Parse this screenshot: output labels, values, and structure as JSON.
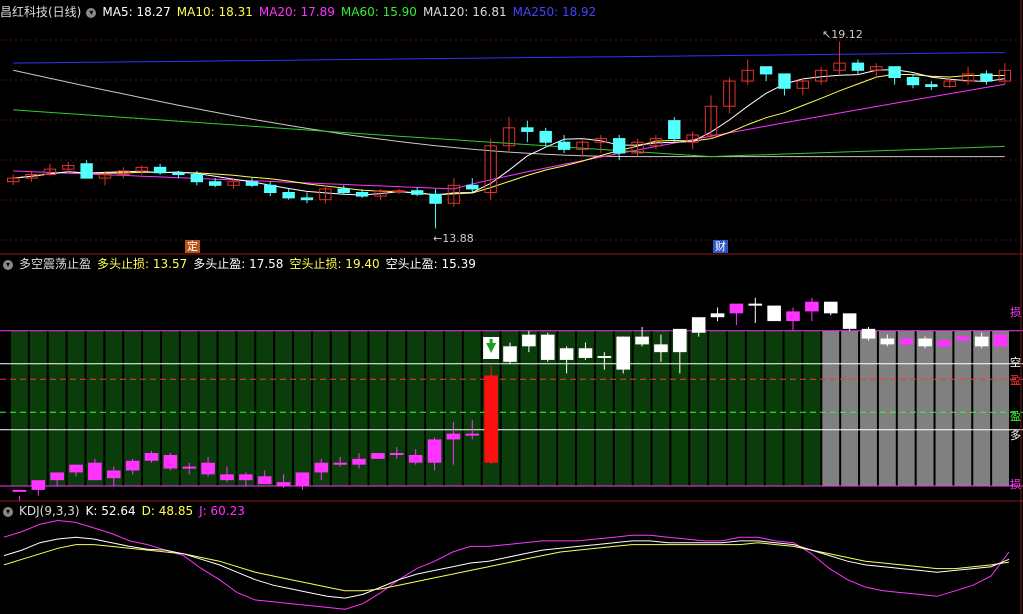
{
  "header_main": {
    "title": "昌红科技(日线)",
    "ma5": "MA5: 18.27",
    "ma10": "MA10: 18.31",
    "ma20": "MA20: 17.89",
    "ma60": "MA60: 15.90",
    "ma120": "MA120: 16.81",
    "ma250": "MA250: 18.92"
  },
  "header_ind": {
    "title": "多空震荡止盈",
    "duo_stop_loss": "多头止损: 13.57",
    "duo_take_profit": "多头止盈: 17.58",
    "kong_stop_loss": "空头止损: 19.40",
    "kong_take_profit": "空头止盈: 15.39"
  },
  "header_kdj": {
    "title": "KDJ(9,3,3)",
    "k": "K: 52.64",
    "d": "D: 48.85",
    "j": "J: 60.23"
  },
  "annotations": {
    "high": "19.12",
    "low": "13.88",
    "badge_ding": "定",
    "badge_cai": "财"
  },
  "right_labels": {
    "sun_top": "损",
    "kong": "空",
    "ying_red": "盈",
    "ying_green": "盈",
    "duo": "多",
    "sun_bottom": "损"
  },
  "colors": {
    "up": "#e0342c",
    "down": "#54ffff",
    "ma5": "#ffffff",
    "ma10": "#ffff55",
    "ma20": "#ff33ff",
    "ma60": "#33cc33",
    "ma120": "#c8c8c8",
    "ma250": "#3333ff",
    "panel_green": "#0b3d0b",
    "panel_gray": "#808080"
  },
  "chart_data": {
    "type": "candlestick",
    "price_ylim": [
      13.3,
      19.7
    ],
    "candles": [
      [
        15.2,
        15.4,
        15.1,
        15.3
      ],
      [
        15.3,
        15.5,
        15.2,
        15.4
      ],
      [
        15.4,
        15.7,
        15.35,
        15.55
      ],
      [
        15.55,
        15.75,
        15.45,
        15.65
      ],
      [
        15.7,
        15.8,
        15.4,
        15.3
      ],
      [
        15.3,
        15.5,
        15.1,
        15.4
      ],
      [
        15.4,
        15.6,
        15.3,
        15.5
      ],
      [
        15.5,
        15.65,
        15.4,
        15.6
      ],
      [
        15.6,
        15.7,
        15.4,
        15.45
      ],
      [
        15.45,
        15.5,
        15.3,
        15.4
      ],
      [
        15.4,
        15.5,
        15.1,
        15.2
      ],
      [
        15.2,
        15.3,
        15.05,
        15.1
      ],
      [
        15.1,
        15.3,
        15.0,
        15.2
      ],
      [
        15.2,
        15.3,
        15.05,
        15.1
      ],
      [
        15.1,
        15.2,
        14.8,
        14.9
      ],
      [
        14.9,
        15.0,
        14.7,
        14.75
      ],
      [
        14.75,
        14.9,
        14.6,
        14.7
      ],
      [
        14.7,
        15.1,
        14.6,
        15.0
      ],
      [
        15.0,
        15.1,
        14.85,
        14.9
      ],
      [
        14.9,
        15.0,
        14.75,
        14.8
      ],
      [
        14.8,
        15.0,
        14.7,
        14.95
      ],
      [
        14.95,
        15.0,
        14.85,
        14.95
      ],
      [
        14.95,
        15.05,
        14.8,
        14.85
      ],
      [
        14.85,
        15.0,
        13.9,
        14.6
      ],
      [
        14.6,
        15.3,
        14.5,
        15.1
      ],
      [
        15.1,
        15.3,
        14.9,
        15.0
      ],
      [
        14.9,
        16.4,
        14.7,
        16.2
      ],
      [
        16.2,
        17.0,
        16.0,
        16.7
      ],
      [
        16.7,
        16.9,
        16.3,
        16.6
      ],
      [
        16.6,
        16.7,
        16.2,
        16.3
      ],
      [
        16.3,
        16.5,
        16.0,
        16.1
      ],
      [
        16.1,
        16.4,
        15.9,
        16.3
      ],
      [
        16.3,
        16.5,
        16.0,
        16.4
      ],
      [
        16.4,
        16.5,
        15.8,
        16.0
      ],
      [
        16.0,
        16.4,
        15.9,
        16.3
      ],
      [
        16.2,
        16.5,
        16.1,
        16.4
      ],
      [
        16.9,
        17.0,
        16.3,
        16.4
      ],
      [
        16.3,
        16.6,
        16.1,
        16.5
      ],
      [
        16.5,
        17.6,
        16.4,
        17.3
      ],
      [
        17.3,
        18.1,
        17.1,
        18.0
      ],
      [
        18.0,
        18.6,
        17.9,
        18.3
      ],
      [
        18.4,
        18.3,
        18.0,
        18.2
      ],
      [
        18.2,
        18.2,
        17.6,
        17.8
      ],
      [
        17.8,
        18.1,
        17.6,
        18.0
      ],
      [
        18.0,
        18.4,
        17.9,
        18.3
      ],
      [
        18.3,
        19.1,
        18.2,
        18.5
      ],
      [
        18.5,
        18.6,
        18.2,
        18.3
      ],
      [
        18.3,
        18.5,
        18.1,
        18.4
      ],
      [
        18.4,
        18.4,
        17.9,
        18.1
      ],
      [
        18.1,
        18.2,
        17.8,
        17.9
      ],
      [
        17.9,
        18.0,
        17.75,
        17.85
      ],
      [
        17.85,
        18.1,
        17.8,
        18.0
      ],
      [
        18.0,
        18.4,
        17.9,
        18.2
      ],
      [
        18.2,
        18.3,
        17.9,
        18.0
      ],
      [
        18.0,
        18.5,
        17.9,
        18.3
      ]
    ],
    "indicator": {
      "top_line": 0.8,
      "kong_line": 0.63,
      "ying_red_line": 0.55,
      "ying_green_line": 0.38,
      "duo_line": 0.29,
      "bottom_line": 0.0,
      "gray_from_index": 43,
      "candles": [
        [
          -0.02,
          -0.05,
          -0.08,
          -0.02
        ],
        [
          -0.02,
          0.02,
          -0.05,
          0.03
        ],
        [
          0.03,
          0.06,
          0.0,
          0.07
        ],
        [
          0.07,
          0.1,
          0.05,
          0.11
        ],
        [
          0.12,
          0.14,
          0.04,
          0.03
        ],
        [
          0.04,
          0.1,
          0.0,
          0.08
        ],
        [
          0.08,
          0.14,
          0.06,
          0.13
        ],
        [
          0.13,
          0.18,
          0.12,
          0.17
        ],
        [
          0.16,
          0.17,
          0.08,
          0.09
        ],
        [
          0.09,
          0.12,
          0.06,
          0.1
        ],
        [
          0.12,
          0.15,
          0.05,
          0.06
        ],
        [
          0.06,
          0.1,
          0.02,
          0.03
        ],
        [
          0.03,
          0.07,
          0.0,
          0.06
        ],
        [
          0.05,
          0.08,
          0.01,
          0.01
        ],
        [
          0.02,
          0.06,
          -0.01,
          0.0
        ],
        [
          0.0,
          0.06,
          -0.02,
          0.07
        ],
        [
          0.07,
          0.14,
          0.03,
          0.12
        ],
        [
          0.12,
          0.15,
          0.1,
          0.11
        ],
        [
          0.11,
          0.17,
          0.09,
          0.14
        ],
        [
          0.14,
          0.17,
          0.14,
          0.17
        ],
        [
          0.17,
          0.2,
          0.14,
          0.16
        ],
        [
          0.16,
          0.19,
          0.11,
          0.12
        ],
        [
          0.12,
          0.25,
          0.08,
          0.24
        ],
        [
          0.24,
          0.33,
          0.11,
          0.27
        ],
        [
          0.26,
          0.34,
          0.24,
          0.27
        ],
        [
          0.12,
          0.62,
          0.11,
          0.57
        ],
        [
          0.64,
          0.74,
          0.63,
          0.72
        ],
        [
          0.72,
          0.8,
          0.69,
          0.78
        ],
        [
          0.78,
          0.79,
          0.64,
          0.65
        ],
        [
          0.65,
          0.72,
          0.58,
          0.71
        ],
        [
          0.71,
          0.74,
          0.65,
          0.66
        ],
        [
          0.66,
          0.69,
          0.6,
          0.67
        ],
        [
          0.6,
          0.77,
          0.58,
          0.77
        ],
        [
          0.77,
          0.82,
          0.72,
          0.73
        ],
        [
          0.73,
          0.78,
          0.64,
          0.69
        ],
        [
          0.69,
          0.8,
          0.58,
          0.81
        ],
        [
          0.79,
          0.86,
          0.77,
          0.87
        ],
        [
          0.87,
          0.92,
          0.85,
          0.89
        ],
        [
          0.89,
          0.93,
          0.83,
          0.94
        ],
        [
          0.94,
          0.97,
          0.84,
          0.93
        ],
        [
          0.93,
          0.93,
          0.89,
          0.85
        ],
        [
          0.85,
          0.92,
          0.8,
          0.9
        ],
        [
          0.9,
          0.97,
          0.85,
          0.95
        ],
        [
          0.95,
          0.95,
          0.88,
          0.89
        ],
        [
          0.89,
          0.89,
          0.8,
          0.81
        ],
        [
          0.81,
          0.82,
          0.75,
          0.76
        ],
        [
          0.76,
          0.78,
          0.72,
          0.73
        ],
        [
          0.73,
          0.77,
          0.7,
          0.76
        ],
        [
          0.76,
          0.77,
          0.71,
          0.72
        ],
        [
          0.72,
          0.76,
          0.7,
          0.75
        ],
        [
          0.75,
          0.78,
          0.73,
          0.77
        ],
        [
          0.77,
          0.79,
          0.71,
          0.72
        ],
        [
          0.72,
          0.79,
          0.71,
          0.78
        ]
      ]
    },
    "kdj": {
      "ylim": [
        0,
        100
      ],
      "K": [
        56,
        62,
        70,
        74,
        76,
        74,
        70,
        66,
        63,
        62,
        58,
        52,
        46,
        38,
        30,
        24,
        20,
        16,
        12,
        10,
        14,
        22,
        30,
        36,
        40,
        44,
        48,
        50,
        54,
        58,
        62,
        64,
        66,
        68,
        70,
        72,
        72,
        70,
        70,
        70,
        70,
        72,
        72,
        70,
        68,
        62,
        56,
        50,
        46,
        44,
        42,
        40,
        38,
        40,
        42,
        44,
        52
      ],
      "D": [
        46,
        52,
        58,
        64,
        68,
        68,
        66,
        64,
        62,
        60,
        58,
        54,
        50,
        44,
        38,
        34,
        30,
        26,
        22,
        18,
        18,
        20,
        24,
        28,
        32,
        36,
        40,
        44,
        48,
        52,
        56,
        60,
        62,
        64,
        66,
        68,
        68,
        68,
        68,
        68,
        68,
        68,
        70,
        68,
        66,
        62,
        58,
        54,
        50,
        48,
        46,
        44,
        42,
        42,
        44,
        46,
        49
      ],
      "J": [
        76,
        82,
        90,
        94,
        92,
        86,
        80,
        72,
        68,
        62,
        56,
        42,
        30,
        16,
        8,
        6,
        4,
        2,
        0,
        -2,
        4,
        16,
        30,
        42,
        50,
        60,
        66,
        66,
        68,
        70,
        72,
        72,
        72,
        74,
        76,
        78,
        78,
        76,
        74,
        72,
        72,
        76,
        76,
        72,
        70,
        58,
        42,
        30,
        22,
        18,
        16,
        14,
        12,
        18,
        24,
        34,
        60
      ]
    }
  }
}
